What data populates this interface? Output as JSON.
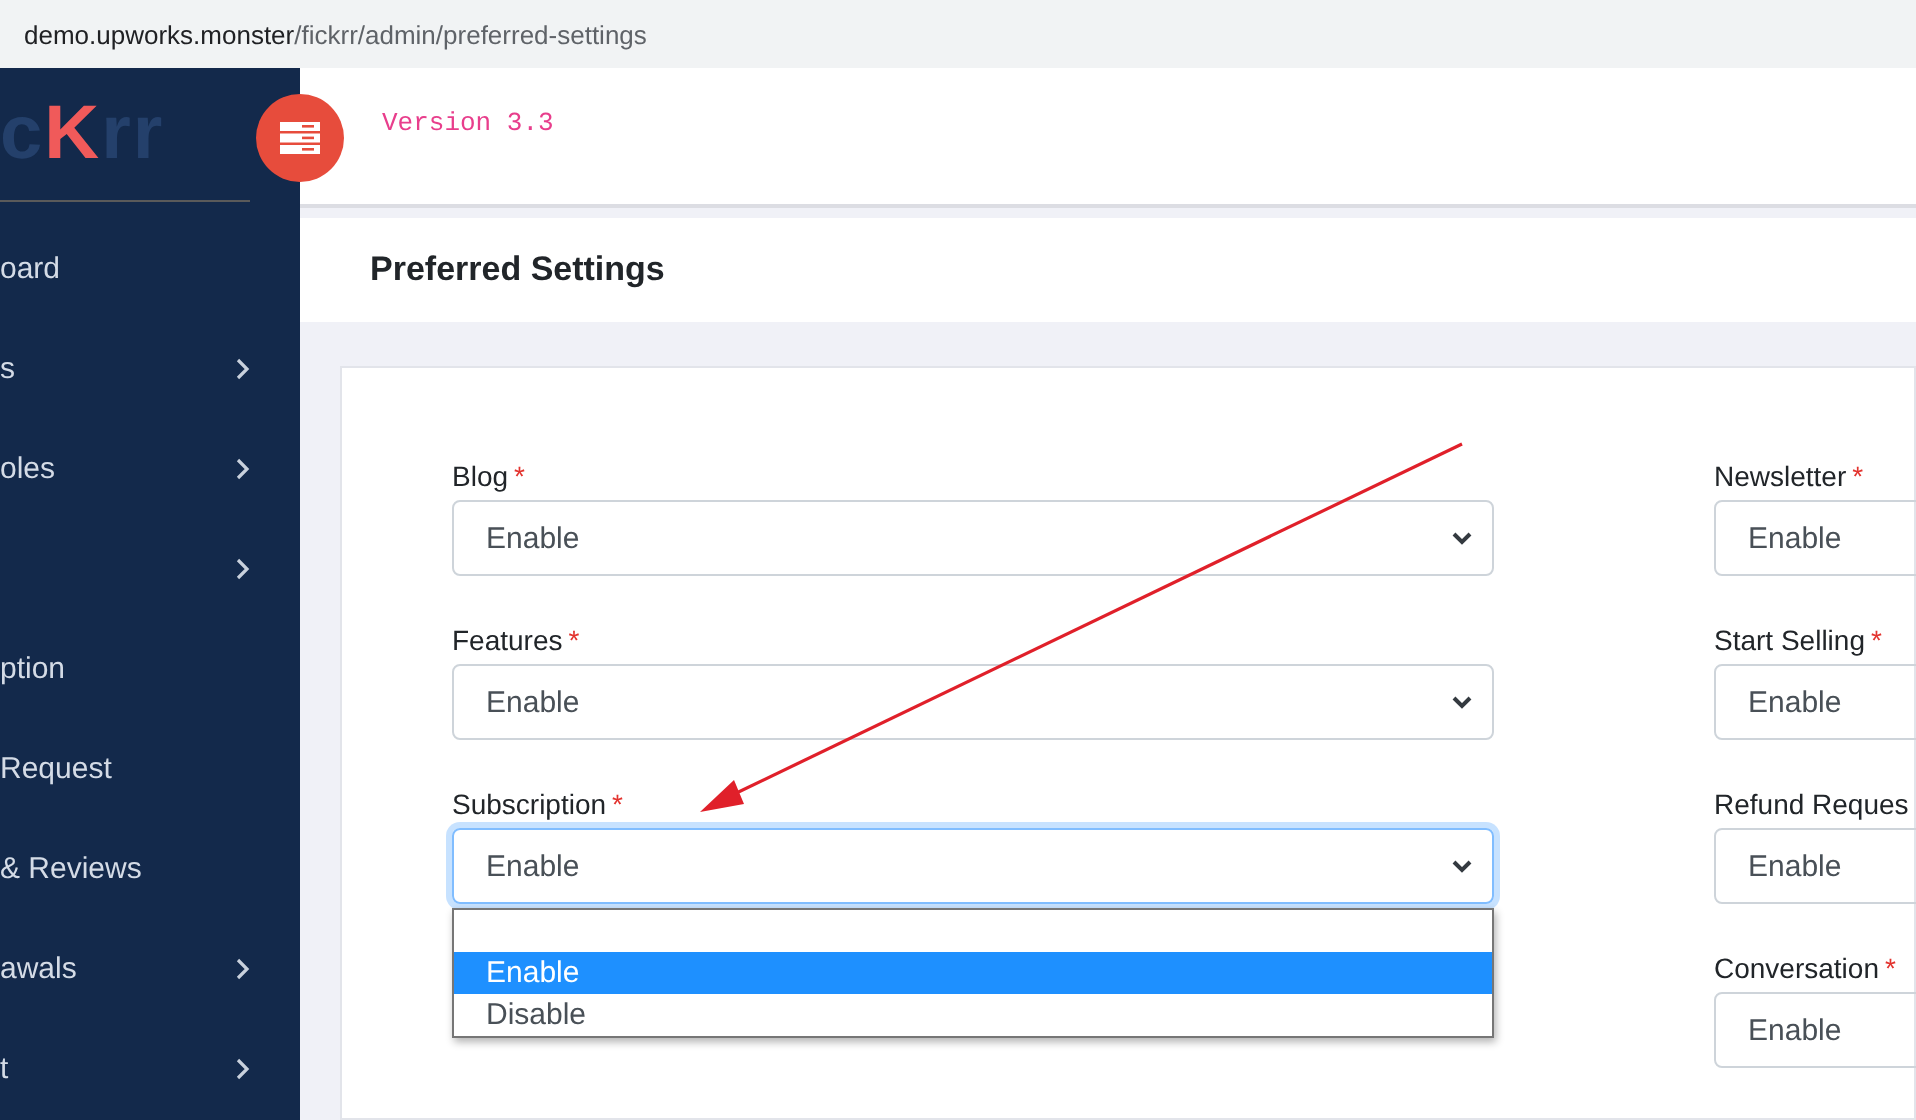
{
  "address_bar": {
    "host": "demo.upworks.monster",
    "path": "/fickrr/admin/preferred-settings"
  },
  "logo": [
    {
      "text": "c",
      "accent": false
    },
    {
      "text": "K",
      "accent": true
    },
    {
      "text": "rr",
      "accent": false
    }
  ],
  "sidebar": {
    "items": [
      {
        "label": "oard",
        "has_children": false
      },
      {
        "label": "s",
        "has_children": true
      },
      {
        "label": "oles",
        "has_children": true
      },
      {
        "has_children": true
      },
      {
        "label": "ption",
        "has_children": false
      },
      {
        "label": " Request",
        "has_children": false
      },
      {
        "label": "& Reviews",
        "has_children": false
      },
      {
        "label": "awals",
        "has_children": true
      },
      {
        "label": "t",
        "has_children": true
      }
    ]
  },
  "header": {
    "version": "Version 3.3"
  },
  "page_title": "Preferred Settings",
  "columns": [
    {
      "fields": [
        {
          "label": "Blog",
          "required_mark": "*",
          "value": "Enable",
          "focused": false
        },
        {
          "label": "Features",
          "required_mark": "*",
          "value": "Enable",
          "focused": false
        },
        {
          "label": "Subscription",
          "required_mark": "*",
          "value": "Enable",
          "focused": true
        }
      ]
    },
    {
      "fields": [
        {
          "label": "Newsletter",
          "required_mark": "*",
          "value": "Enable",
          "focused": false
        },
        {
          "label": "Start Selling",
          "required_mark": "*",
          "value": "Enable",
          "focused": false
        },
        {
          "label": "Refund Reques",
          "value": "Enable",
          "focused": false
        },
        {
          "label": "Conversation",
          "required_mark": "*",
          "value": "Enable",
          "focused": false
        }
      ]
    }
  ],
  "dropdown": {
    "options": [
      {
        "label": "Enable",
        "selected": true
      },
      {
        "label": "Disable",
        "selected": false
      }
    ]
  }
}
